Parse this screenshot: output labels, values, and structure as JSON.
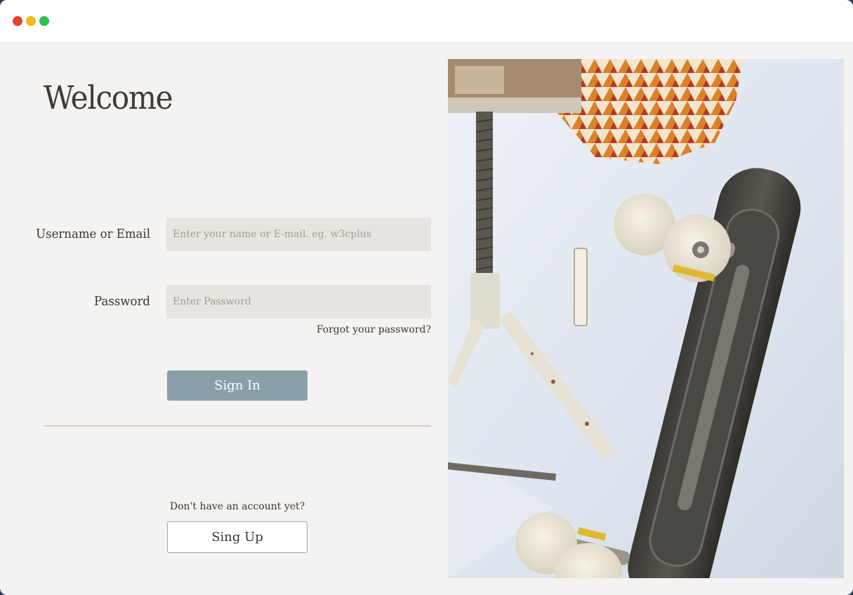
{
  "window": {
    "controls": [
      "close",
      "minimize",
      "maximize"
    ]
  },
  "login": {
    "heading": "Welcome",
    "username_label": "Username or Email",
    "username_placeholder": "Enter your name or E-mail. eg. w3cplus",
    "password_label": "Password",
    "password_placeholder": "Enter Password",
    "forgot_link": "Forgot your password?",
    "signin_button": "Sign In",
    "no_account_text": "Don't have an account yet?",
    "signup_button": "Sing Up"
  },
  "photo": {
    "subject": "skateboard-leaning-on-wall"
  },
  "colors": {
    "background": "#f5f3f1",
    "input_bg": "#e8e4df",
    "signin_bg": "#8aa0a9",
    "text": "#3a352f"
  }
}
